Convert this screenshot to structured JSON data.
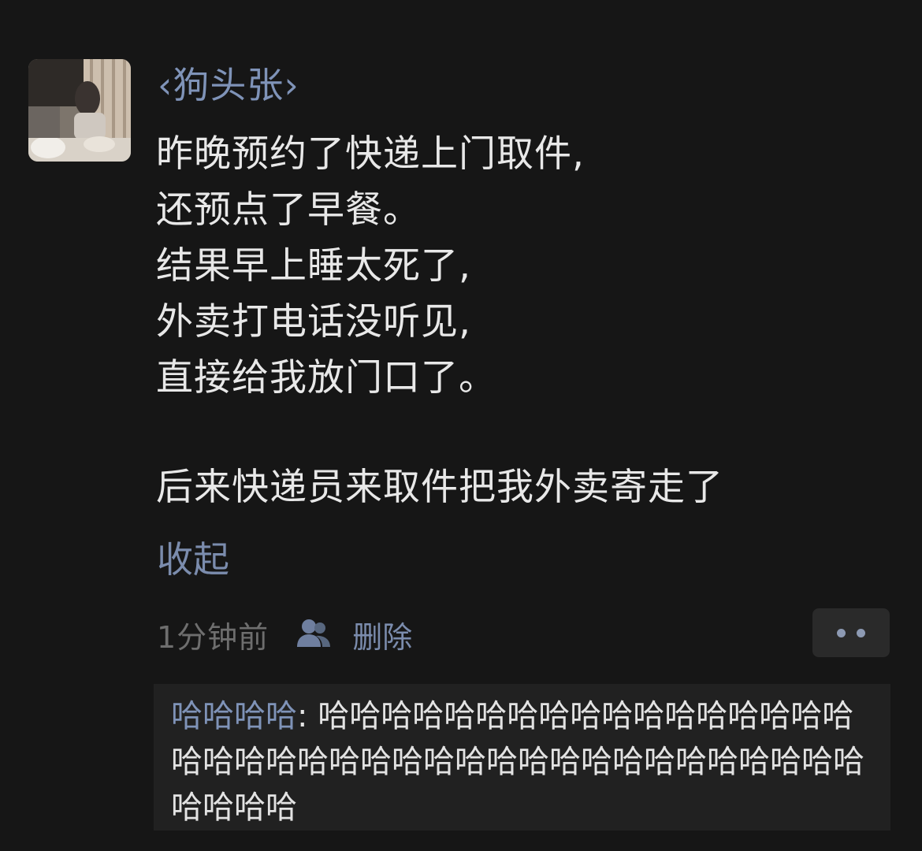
{
  "post": {
    "username": "‹狗头张›",
    "lines": [
      "昨晚预约了快递上门取件,",
      "还预点了早餐。",
      "结果早上睡太死了,",
      "外卖打电话没听见,",
      "直接给我放门口了。",
      "后来快递员来取件把我外卖寄走了"
    ],
    "collapse_label": "收起",
    "timestamp": "1分钟前",
    "visibility_icon": "friends-icon",
    "delete_label": "删除",
    "more_icon": "more-dots-icon"
  },
  "comment": {
    "author": "哈哈哈哈",
    "separator": ": ",
    "text": "哈哈哈哈哈哈哈哈哈哈哈哈哈哈哈哈哈哈哈哈哈哈哈哈哈哈哈哈哈哈哈哈哈哈哈哈哈哈哈哈哈哈哈"
  },
  "colors": {
    "background": "#161616",
    "link": "#7b8cad",
    "text": "#e8e8e8",
    "muted": "#6e6e6e",
    "comment_bg": "#212121"
  }
}
